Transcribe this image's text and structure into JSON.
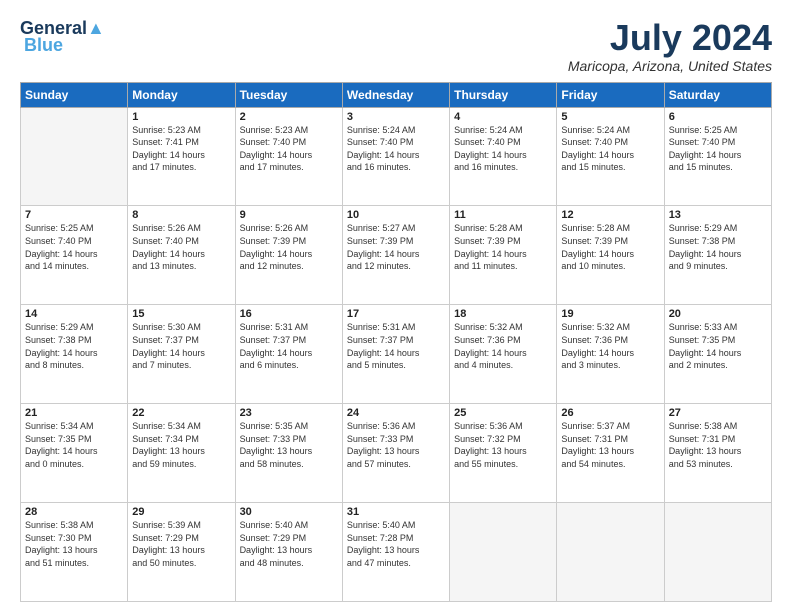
{
  "header": {
    "logo_line1": "General",
    "logo_line2": "Blue",
    "month": "July 2024",
    "location": "Maricopa, Arizona, United States"
  },
  "weekdays": [
    "Sunday",
    "Monday",
    "Tuesday",
    "Wednesday",
    "Thursday",
    "Friday",
    "Saturday"
  ],
  "weeks": [
    [
      {
        "day": "",
        "info": ""
      },
      {
        "day": "1",
        "info": "Sunrise: 5:23 AM\nSunset: 7:41 PM\nDaylight: 14 hours\nand 17 minutes."
      },
      {
        "day": "2",
        "info": "Sunrise: 5:23 AM\nSunset: 7:40 PM\nDaylight: 14 hours\nand 17 minutes."
      },
      {
        "day": "3",
        "info": "Sunrise: 5:24 AM\nSunset: 7:40 PM\nDaylight: 14 hours\nand 16 minutes."
      },
      {
        "day": "4",
        "info": "Sunrise: 5:24 AM\nSunset: 7:40 PM\nDaylight: 14 hours\nand 16 minutes."
      },
      {
        "day": "5",
        "info": "Sunrise: 5:24 AM\nSunset: 7:40 PM\nDaylight: 14 hours\nand 15 minutes."
      },
      {
        "day": "6",
        "info": "Sunrise: 5:25 AM\nSunset: 7:40 PM\nDaylight: 14 hours\nand 15 minutes."
      }
    ],
    [
      {
        "day": "7",
        "info": "Sunrise: 5:25 AM\nSunset: 7:40 PM\nDaylight: 14 hours\nand 14 minutes."
      },
      {
        "day": "8",
        "info": "Sunrise: 5:26 AM\nSunset: 7:40 PM\nDaylight: 14 hours\nand 13 minutes."
      },
      {
        "day": "9",
        "info": "Sunrise: 5:26 AM\nSunset: 7:39 PM\nDaylight: 14 hours\nand 12 minutes."
      },
      {
        "day": "10",
        "info": "Sunrise: 5:27 AM\nSunset: 7:39 PM\nDaylight: 14 hours\nand 12 minutes."
      },
      {
        "day": "11",
        "info": "Sunrise: 5:28 AM\nSunset: 7:39 PM\nDaylight: 14 hours\nand 11 minutes."
      },
      {
        "day": "12",
        "info": "Sunrise: 5:28 AM\nSunset: 7:39 PM\nDaylight: 14 hours\nand 10 minutes."
      },
      {
        "day": "13",
        "info": "Sunrise: 5:29 AM\nSunset: 7:38 PM\nDaylight: 14 hours\nand 9 minutes."
      }
    ],
    [
      {
        "day": "14",
        "info": "Sunrise: 5:29 AM\nSunset: 7:38 PM\nDaylight: 14 hours\nand 8 minutes."
      },
      {
        "day": "15",
        "info": "Sunrise: 5:30 AM\nSunset: 7:37 PM\nDaylight: 14 hours\nand 7 minutes."
      },
      {
        "day": "16",
        "info": "Sunrise: 5:31 AM\nSunset: 7:37 PM\nDaylight: 14 hours\nand 6 minutes."
      },
      {
        "day": "17",
        "info": "Sunrise: 5:31 AM\nSunset: 7:37 PM\nDaylight: 14 hours\nand 5 minutes."
      },
      {
        "day": "18",
        "info": "Sunrise: 5:32 AM\nSunset: 7:36 PM\nDaylight: 14 hours\nand 4 minutes."
      },
      {
        "day": "19",
        "info": "Sunrise: 5:32 AM\nSunset: 7:36 PM\nDaylight: 14 hours\nand 3 minutes."
      },
      {
        "day": "20",
        "info": "Sunrise: 5:33 AM\nSunset: 7:35 PM\nDaylight: 14 hours\nand 2 minutes."
      }
    ],
    [
      {
        "day": "21",
        "info": "Sunrise: 5:34 AM\nSunset: 7:35 PM\nDaylight: 14 hours\nand 0 minutes."
      },
      {
        "day": "22",
        "info": "Sunrise: 5:34 AM\nSunset: 7:34 PM\nDaylight: 13 hours\nand 59 minutes."
      },
      {
        "day": "23",
        "info": "Sunrise: 5:35 AM\nSunset: 7:33 PM\nDaylight: 13 hours\nand 58 minutes."
      },
      {
        "day": "24",
        "info": "Sunrise: 5:36 AM\nSunset: 7:33 PM\nDaylight: 13 hours\nand 57 minutes."
      },
      {
        "day": "25",
        "info": "Sunrise: 5:36 AM\nSunset: 7:32 PM\nDaylight: 13 hours\nand 55 minutes."
      },
      {
        "day": "26",
        "info": "Sunrise: 5:37 AM\nSunset: 7:31 PM\nDaylight: 13 hours\nand 54 minutes."
      },
      {
        "day": "27",
        "info": "Sunrise: 5:38 AM\nSunset: 7:31 PM\nDaylight: 13 hours\nand 53 minutes."
      }
    ],
    [
      {
        "day": "28",
        "info": "Sunrise: 5:38 AM\nSunset: 7:30 PM\nDaylight: 13 hours\nand 51 minutes."
      },
      {
        "day": "29",
        "info": "Sunrise: 5:39 AM\nSunset: 7:29 PM\nDaylight: 13 hours\nand 50 minutes."
      },
      {
        "day": "30",
        "info": "Sunrise: 5:40 AM\nSunset: 7:29 PM\nDaylight: 13 hours\nand 48 minutes."
      },
      {
        "day": "31",
        "info": "Sunrise: 5:40 AM\nSunset: 7:28 PM\nDaylight: 13 hours\nand 47 minutes."
      },
      {
        "day": "",
        "info": ""
      },
      {
        "day": "",
        "info": ""
      },
      {
        "day": "",
        "info": ""
      }
    ]
  ]
}
